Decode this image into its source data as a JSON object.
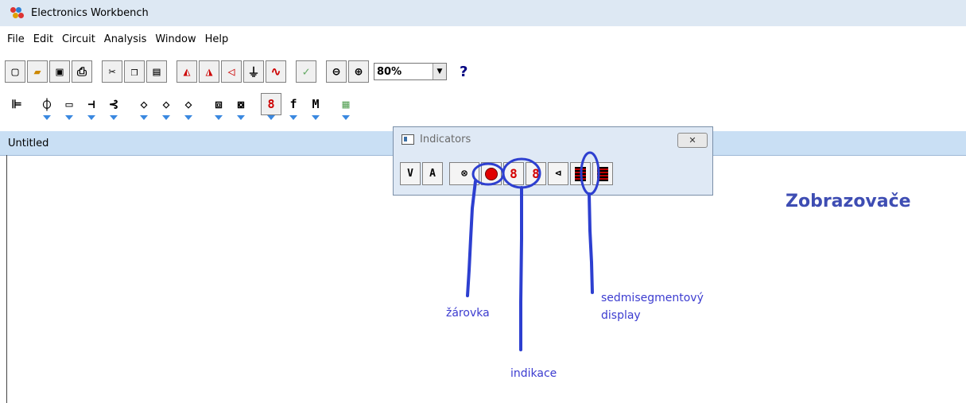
{
  "window": {
    "title": "Electronics Workbench"
  },
  "menu": [
    "File",
    "Edit",
    "Circuit",
    "Analysis",
    "Window",
    "Help"
  ],
  "toolbar": {
    "zoom_value": "80%",
    "help_label": "?"
  },
  "document": {
    "title": "Untitled"
  },
  "palette": {
    "title": "Indicators",
    "items": [
      {
        "name": "voltmeter",
        "label": "V"
      },
      {
        "name": "ammeter",
        "label": "A"
      },
      {
        "name": "bulb",
        "label": "⊗"
      },
      {
        "name": "probe-led",
        "label": ""
      },
      {
        "name": "seven-segment-display",
        "label": "8"
      },
      {
        "name": "decoded-seven-segment-display",
        "label": "8"
      },
      {
        "name": "buzzer",
        "label": "⊲"
      },
      {
        "name": "bargraph",
        "label": ""
      },
      {
        "name": "decoded-bargraph",
        "label": ""
      }
    ]
  },
  "annotations": {
    "heading": "Zobrazovače",
    "bulb_label": "žárovka",
    "indicator_label": "indikace",
    "display_label_line1": "sedmisegmentový",
    "display_label_line2": "display",
    "color": "#3c3cd0"
  }
}
